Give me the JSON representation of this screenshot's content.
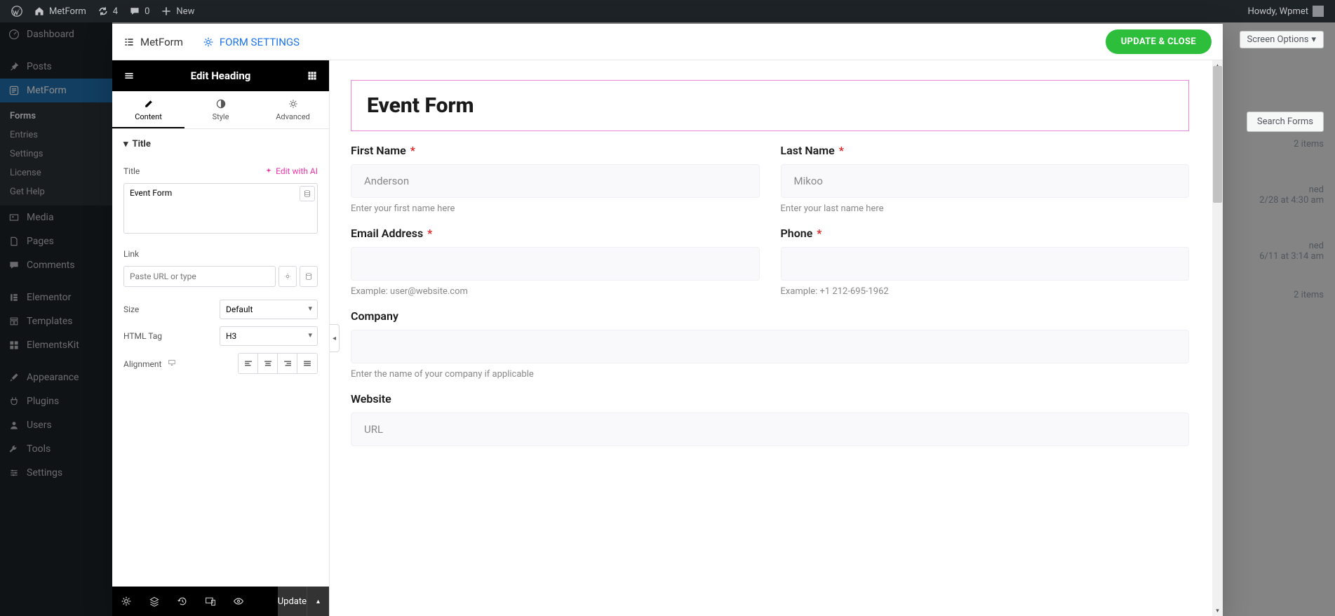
{
  "adminbar": {
    "site_name": "MetForm",
    "refresh_count": "4",
    "comments_count": "0",
    "new_label": "New",
    "howdy": "Howdy, Wpmet"
  },
  "wp_sidebar": {
    "items": [
      {
        "label": "Dashboard"
      },
      {
        "label": "Posts"
      },
      {
        "label": "MetForm",
        "current": true
      },
      {
        "label": "Media"
      },
      {
        "label": "Pages"
      },
      {
        "label": "Comments"
      },
      {
        "label": "Elementor"
      },
      {
        "label": "Templates"
      },
      {
        "label": "ElementsKit"
      },
      {
        "label": "Appearance"
      },
      {
        "label": "Plugins"
      },
      {
        "label": "Users"
      },
      {
        "label": "Tools"
      },
      {
        "label": "Settings"
      }
    ],
    "submenu": [
      "Forms",
      "Entries",
      "Settings",
      "License",
      "Get Help"
    ],
    "submenu_current": "Forms"
  },
  "back_panel": {
    "screen_options": "Screen Options",
    "search_forms": "Search Forms",
    "items_count": "2 items",
    "row1_sub": "ned",
    "row1_date": "2/28 at 4:30 am",
    "row2_sub": "ned",
    "row2_date": "6/11 at 3:14 am"
  },
  "modal_header": {
    "metform": "MetForm",
    "form_settings": "FORM SETTINGS",
    "update_close": "UPDATE & CLOSE"
  },
  "el_panel": {
    "title": "Edit Heading",
    "tabs": {
      "content": "Content",
      "style": "Style",
      "advanced": "Advanced"
    },
    "section_title": "Title",
    "title_label": "Title",
    "edit_ai": "Edit with AI",
    "title_value": "Event Form",
    "link_label": "Link",
    "link_placeholder": "Paste URL or type",
    "size_label": "Size",
    "size_value": "Default",
    "htmltag_label": "HTML Tag",
    "htmltag_value": "H3",
    "alignment_label": "Alignment",
    "footer_update": "Update"
  },
  "preview": {
    "heading": "Event Form",
    "fields": {
      "first_name": {
        "label": "First Name",
        "placeholder": "Anderson",
        "help": "Enter your first name here"
      },
      "last_name": {
        "label": "Last Name",
        "placeholder": "Mikoo",
        "help": "Enter your last name here"
      },
      "email": {
        "label": "Email Address",
        "help": "Example: user@website.com"
      },
      "phone": {
        "label": "Phone",
        "help": "Example: +1 212-695-1962"
      },
      "company": {
        "label": "Company",
        "help": "Enter the name of your company if applicable"
      },
      "website": {
        "label": "Website",
        "placeholder": "URL"
      }
    }
  }
}
